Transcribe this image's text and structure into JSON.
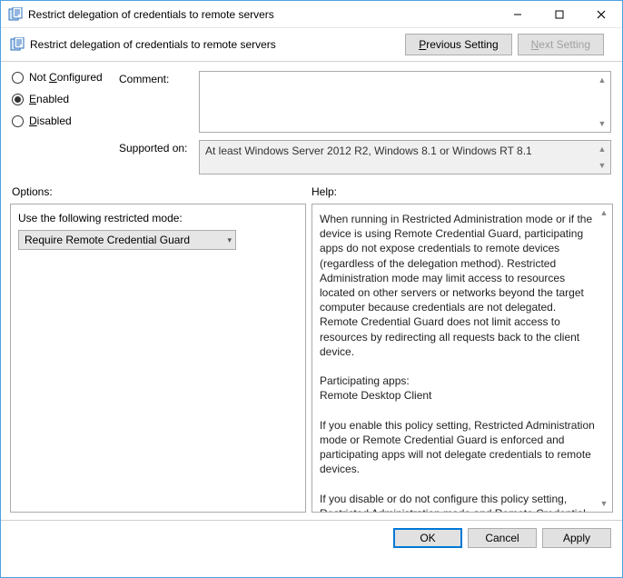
{
  "window": {
    "title": "Restrict delegation of credentials to remote servers"
  },
  "subheader": {
    "title": "Restrict delegation of credentials to remote servers",
    "prev_btn": "Previous Setting",
    "next_btn": "Next Setting"
  },
  "state": {
    "not_configured": "Not Configured",
    "enabled": "Enabled",
    "disabled": "Disabled",
    "selected": "enabled"
  },
  "labels": {
    "comment": "Comment:",
    "supported": "Supported on:",
    "options": "Options:",
    "help": "Help:"
  },
  "comment_text": "",
  "supported_text": "At least Windows Server 2012 R2, Windows 8.1 or Windows RT 8.1",
  "options": {
    "mode_label": "Use the following restricted mode:",
    "mode_value": "Require Remote Credential Guard"
  },
  "help_text": "When running in Restricted Administration mode or if the device is using Remote Credential Guard, participating apps do not expose credentials to remote devices (regardless of the delegation method). Restricted Administration mode may limit access to resources located on other servers or networks beyond the target computer because credentials are not delegated. Remote Credential Guard does not limit access to resources by redirecting all requests back to the client device.\n\nParticipating apps:\nRemote Desktop Client\n\nIf you enable this policy setting, Restricted Administration mode or Remote Credential Guard is enforced and participating apps will not delegate credentials to remote devices.\n\nIf you disable or do not configure this policy setting, Restricted Administration mode and Remote Credential Guard are not enforced and participating apps can delegate credentials to remote devices.",
  "footer": {
    "ok": "OK",
    "cancel": "Cancel",
    "apply": "Apply"
  }
}
